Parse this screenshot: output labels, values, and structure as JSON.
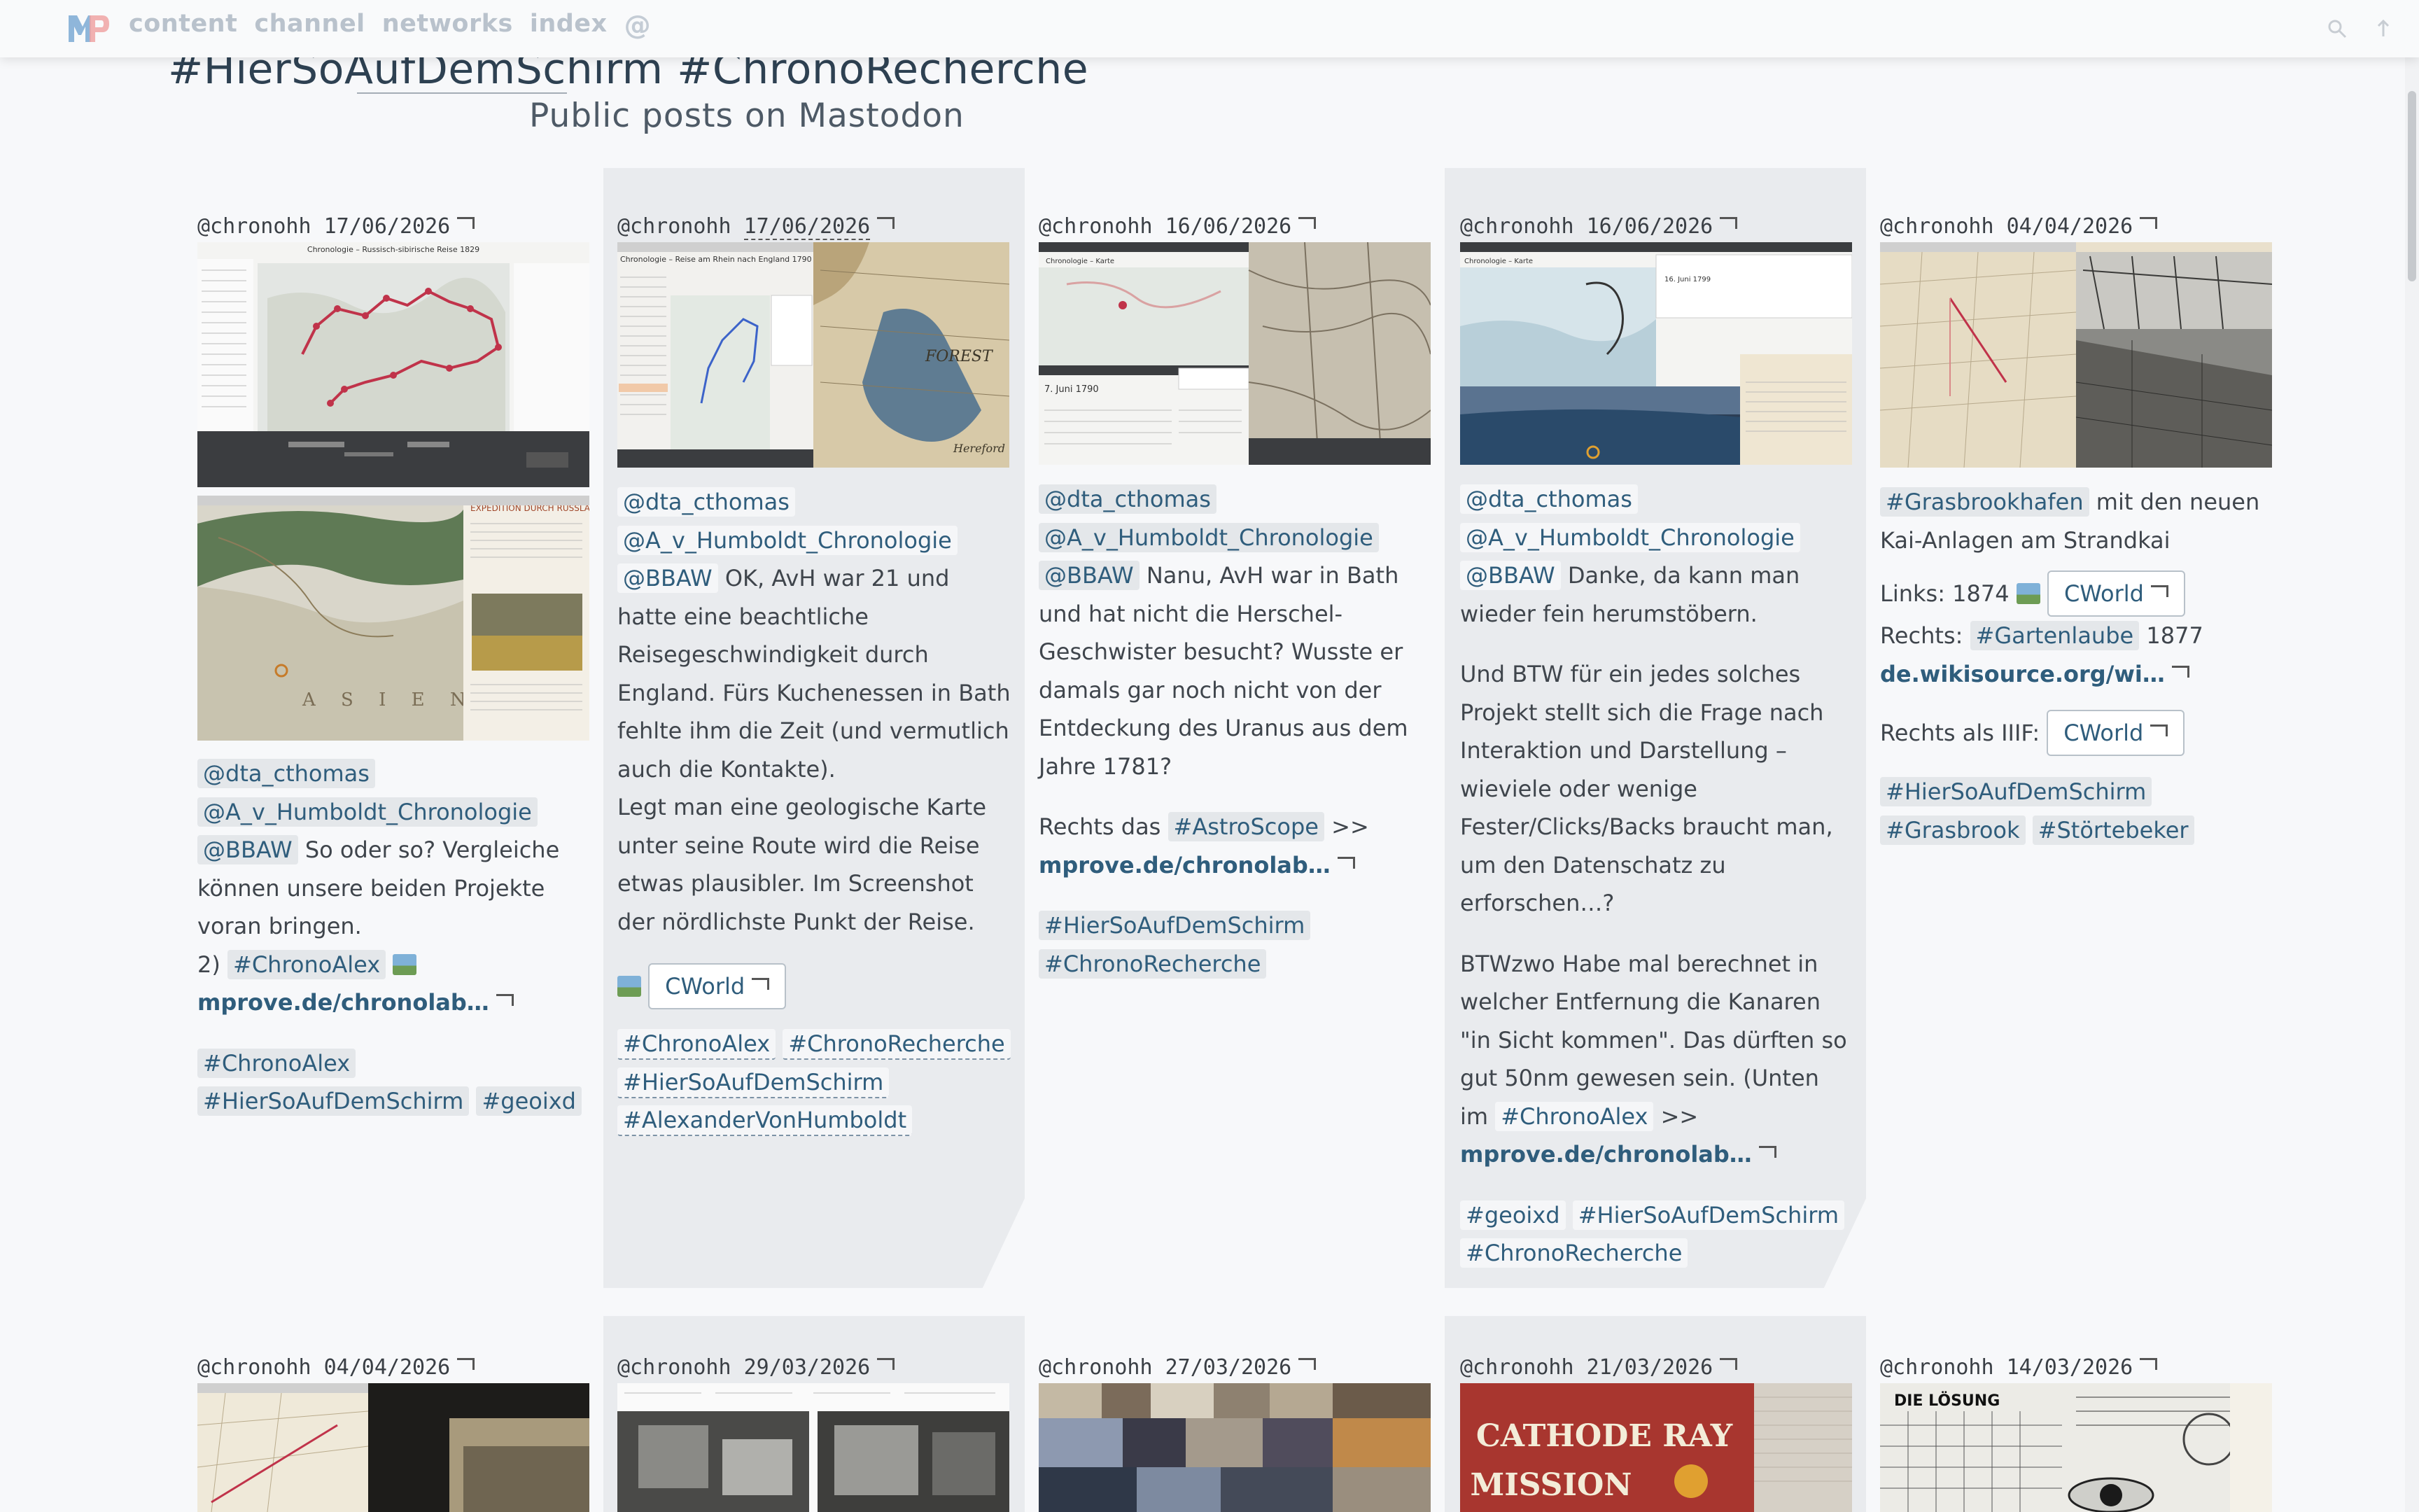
{
  "nav": {
    "items": [
      "content",
      "channel",
      "networks",
      "index"
    ],
    "at": "@"
  },
  "header": {
    "title": "#HierSoAufDemSchirm #ChronoRecherche",
    "subtitle": "Public posts on Mastodon"
  },
  "icons": {
    "logo": "mp-logo",
    "search": "search-icon",
    "up": "arrow-up-icon"
  },
  "posts": [
    {
      "author": "@chronohh",
      "date": "17/06/2026",
      "mentions": [
        "@dta_cthomas",
        "@A_v_Humboldt_Chronologie",
        "@BBAW"
      ],
      "text": "So oder so? Vergleiche können unsere beiden Projekte voran bringen.",
      "text2": "2)",
      "inline_tag": "#ChronoAlex",
      "link": "mprove.de/chronolab…",
      "tags": [
        "#ChronoAlex",
        "#HierSoAufDemSchirm",
        "#geoixd"
      ],
      "image1_title": "Chronologie – Russisch-sibirische Reise 1829",
      "image2_title": "EXPEDITION DURCH RUSSLAND"
    },
    {
      "author": "@chronohh",
      "date": "17/06/2026",
      "mentions": [
        "@dta_cthomas",
        "@A_v_Humboldt_Chronologie",
        "@BBAW"
      ],
      "text": "OK, AvH war 21 und hatte eine beachtliche Reisegeschwindigkeit durch England. Fürs Kuchenessen in Bath fehlte ihm die Zeit (und vermutlich auch die Kontakte).",
      "text2": "Legt man eine geologische Karte unter seine Route wird die Reise etwas plausibler. Im Screenshot der nördlichste Punkt der Reise.",
      "button": "CWorld",
      "tags": [
        "#ChronoAlex",
        "#ChronoRecherche",
        "#HierSoAufDemSchirm",
        "#AlexanderVonHumboldt"
      ],
      "image_title": "Chronologie – Reise am Rhein nach England 1790"
    },
    {
      "author": "@chronohh",
      "date": "16/06/2026",
      "mentions": [
        "@dta_cthomas",
        "@A_v_Humboldt_Chronologie",
        "@BBAW"
      ],
      "text": "Nanu, AvH war in Bath und hat nicht die Herschel-Geschwister besucht? Wusste er damals gar noch nicht von der Entdeckung des Uranus aus dem Jahre 1781?",
      "text2_prefix": "Rechts das",
      "inline_tag": "#AstroScope",
      "text2_suffix": ">>",
      "link": "mprove.de/chronolab…",
      "tags": [
        "#HierSoAufDemSchirm",
        "#ChronoRecherche"
      ],
      "image_title": "Chronologie – Karte",
      "image_date": "7. Juni 1790"
    },
    {
      "author": "@chronohh",
      "date": "16/06/2026",
      "mentions": [
        "@dta_cthomas",
        "@A_v_Humboldt_Chronologie",
        "@BBAW"
      ],
      "text": "Danke, da kann man wieder fein herumstöbern.",
      "text2": "Und BTW für ein jedes solches Projekt stellt sich die Frage nach Interaktion und Darstellung – wieviele oder wenige Fester/Clicks/Backs braucht man, um den Datenschatz zu erforschen…?",
      "text3": "BTWzwo Habe mal berechnet in welcher Entfernung die Kanaren \"in Sicht kommen\". Das dürften so gut 50nm gewesen sein. (Unten im",
      "inline_tag": "#ChronoAlex",
      "text3_suffix": ">>",
      "link": "mprove.de/chronolab…",
      "tags": [
        "#geoixd",
        "#HierSoAufDemSchirm",
        "#ChronoRecherche"
      ],
      "image_title": "Chronologie – Karte",
      "image_date": "16. Juni 1799"
    },
    {
      "author": "@chronohh",
      "date": "04/04/2026",
      "lead_tag": "#Grasbrookhafen",
      "text": "mit den neuen Kai-Anlagen am Strandkai",
      "links_prefix": "Links: 1874",
      "button1": "CWorld",
      "rechts_prefix": "Rechts:",
      "rechts_tag": "#Gartenlaube",
      "rechts_year": "1877",
      "link": "de.wikisource.org/wi…",
      "iiif_prefix": "Rechts als IIIF:",
      "button2": "CWorld",
      "tags": [
        "#HierSoAufDemSchirm",
        "#Grasbrook",
        "#Störtebeker"
      ]
    }
  ],
  "posts_row2": [
    {
      "author": "@chronohh",
      "date": "04/04/2026"
    },
    {
      "author": "@chronohh",
      "date": "29/03/2026"
    },
    {
      "author": "@chronohh",
      "date": "27/03/2026"
    },
    {
      "author": "@chronohh",
      "date": "21/03/2026",
      "image_text1": "CATHODE RAY",
      "image_text2": "MISSION"
    },
    {
      "author": "@chronohh",
      "date": "14/03/2026",
      "image_text": "DIE LÖSUNG"
    }
  ]
}
